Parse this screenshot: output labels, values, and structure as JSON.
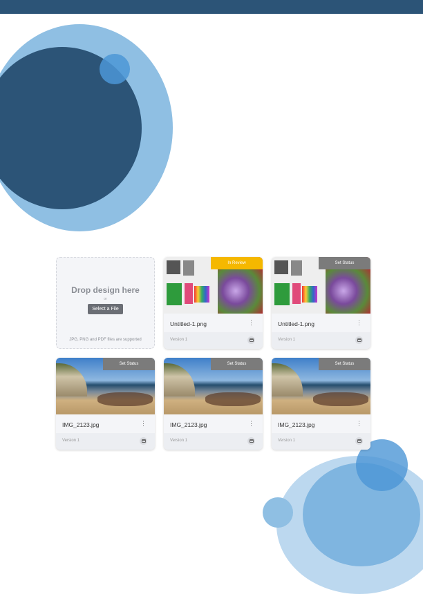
{
  "colors": {
    "header": "#2c5477",
    "in_review": "#f5b800",
    "set_status": "#7b7b7b"
  },
  "upload": {
    "title": "Drop design here",
    "or": "or",
    "button": "Select a File",
    "hint": "JPG, PNG and PDF files are supported"
  },
  "cards": [
    {
      "name": "Untitled-1.png",
      "version": "Version 1",
      "status": "In Review",
      "image": "collage"
    },
    {
      "name": "Untitled-1.png",
      "version": "Version 1",
      "status": "Set Status",
      "image": "collage"
    },
    {
      "name": "IMG_2123.jpg",
      "version": "Version 1",
      "status": "Set Status",
      "image": "beach"
    },
    {
      "name": "IMG_2123.jpg",
      "version": "Version 1",
      "status": "Set Status",
      "image": "beach"
    },
    {
      "name": "IMG_2123.jpg",
      "version": "Version 1",
      "status": "Set Status",
      "image": "beach"
    }
  ]
}
